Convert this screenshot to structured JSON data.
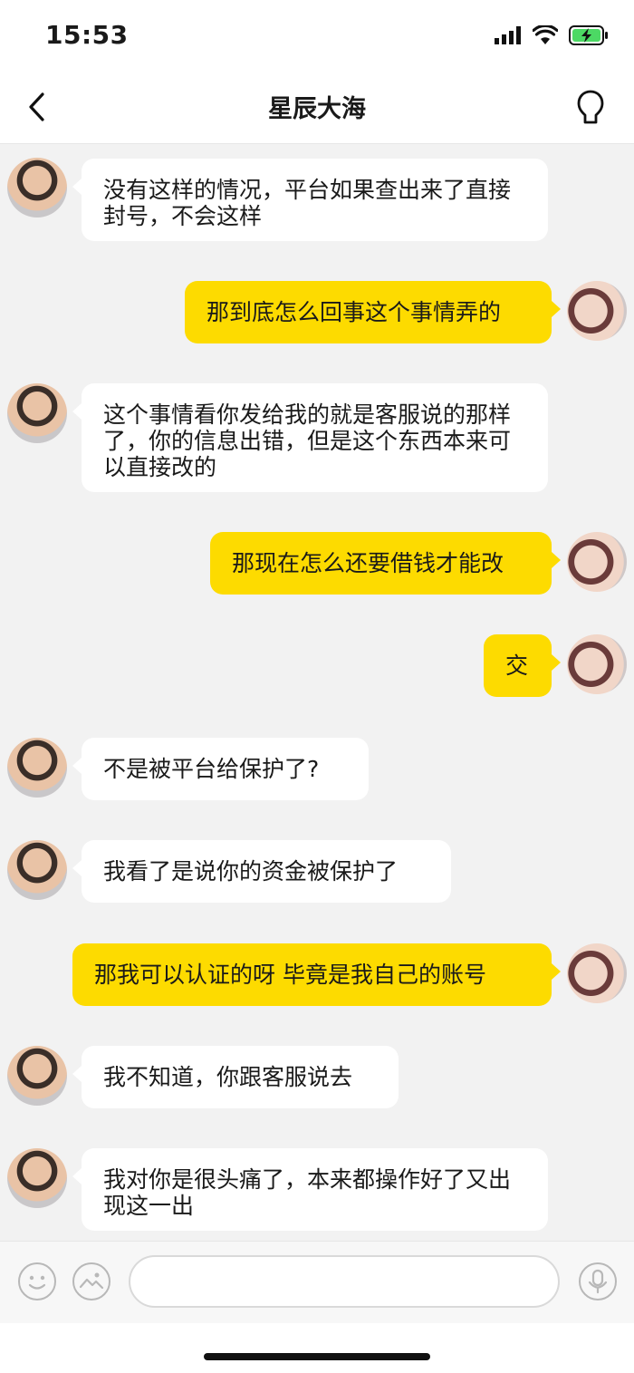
{
  "status_bar": {
    "time": "15:53"
  },
  "header": {
    "title": "星辰大海"
  },
  "messages": [
    {
      "sender": "other",
      "text": "没有这样的情况，平台如果查出来了直接封号，不会这样"
    },
    {
      "sender": "me",
      "text": "那到底怎么回事这个事情弄的"
    },
    {
      "sender": "other",
      "text": "这个事情看你发给我的就是客服说的那样了，你的信息出错，但是这个东西本来可以直接改的"
    },
    {
      "sender": "me",
      "text": "那现在怎么还要借钱才能改"
    },
    {
      "sender": "me",
      "text": "交"
    },
    {
      "sender": "other",
      "text": "不是被平台给保护了?"
    },
    {
      "sender": "other",
      "text": "我看了是说你的资金被保护了"
    },
    {
      "sender": "me",
      "text": "那我可以认证的呀  毕竟是我自己的账号"
    },
    {
      "sender": "other",
      "text": "我不知道，你跟客服说去"
    },
    {
      "sender": "other",
      "text": "我对你是很头痛了，本来都操作好了又出现这一出"
    }
  ],
  "input": {
    "placeholder": "",
    "value": ""
  },
  "icons": {
    "back": "chevron-left-icon",
    "profile": "person-outline-icon",
    "emoji": "emoji-icon",
    "image": "image-icon",
    "voice": "microphone-icon"
  },
  "colors": {
    "my_bubble": "#fddb00",
    "their_bubble": "#ffffff",
    "background": "#f2f2f2"
  }
}
